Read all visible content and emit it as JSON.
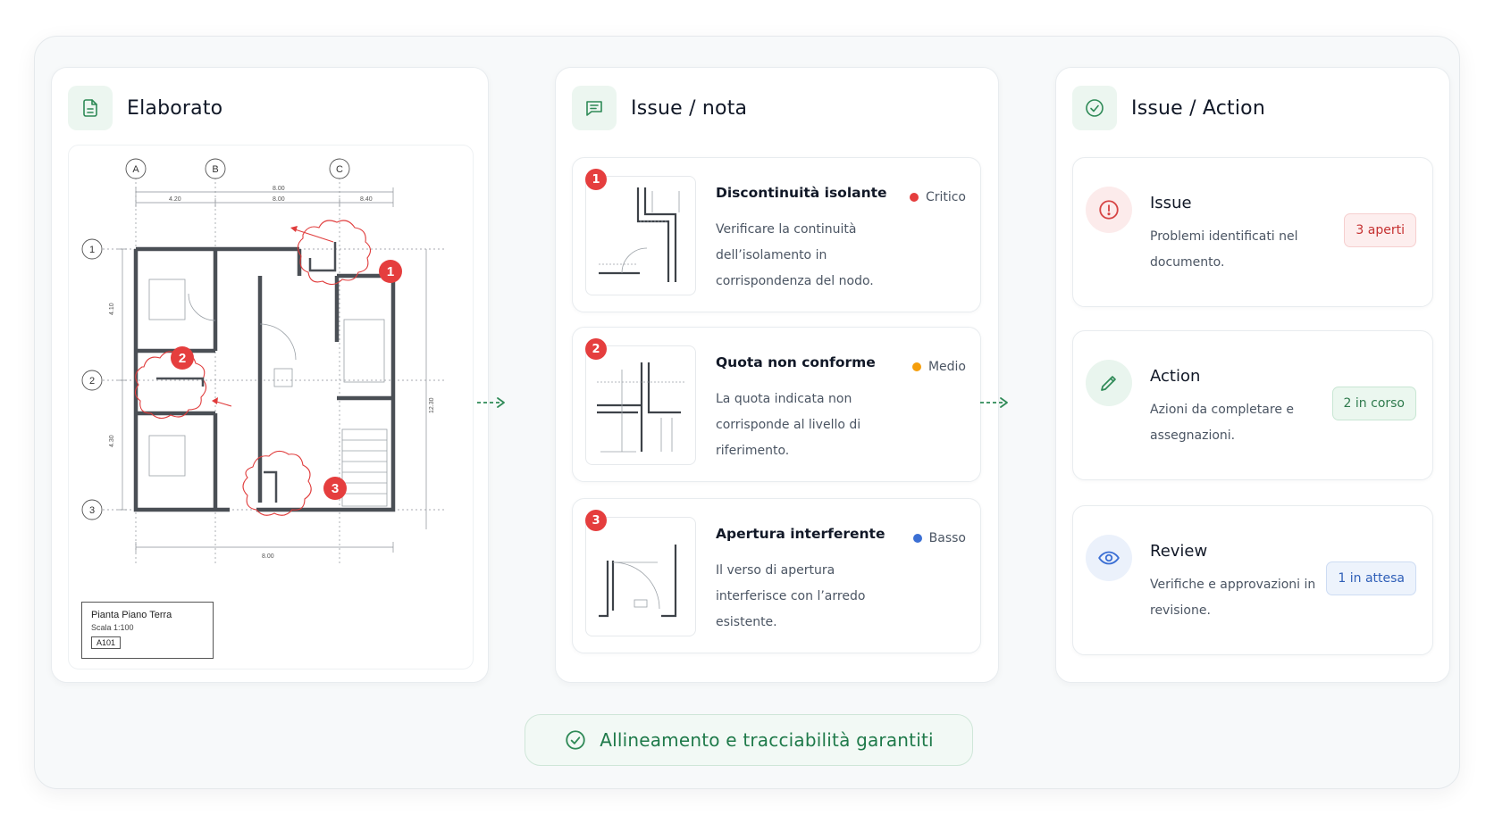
{
  "panels": {
    "document": {
      "title": "Elaborato",
      "icon": "document-icon",
      "drawing": {
        "column_labels": [
          "A",
          "B",
          "C"
        ],
        "row_labels": [
          "1",
          "2",
          "3"
        ],
        "dimensions": [
          "8.00",
          "4.20",
          "8.00",
          "8.40",
          "4.10",
          "4.30",
          "12.30",
          "8.00"
        ],
        "markers": [
          "1",
          "2",
          "3"
        ],
        "title_block": {
          "name": "Pianta Piano Terra",
          "scale": "Scala 1:100",
          "code": "A101"
        }
      }
    },
    "issues": {
      "title": "Issue / nota",
      "icon": "chat-note-icon",
      "items": [
        {
          "number": "1",
          "title": "Discontinuità isolante",
          "severity": "Critico",
          "severity_color": "#e53e3e",
          "description": "Verificare la continuità dell’isolamento in corrispondenza del nodo."
        },
        {
          "number": "2",
          "title": "Quota non conforme",
          "severity": "Medio",
          "severity_color": "#f59e0b",
          "description": "La quota indicata non corrisponde al livello di riferimento."
        },
        {
          "number": "3",
          "title": "Apertura interferente",
          "severity": "Basso",
          "severity_color": "#3b6fd4",
          "description": "Il verso di apertura interferisce con l’arredo esistente."
        }
      ]
    },
    "actions": {
      "title": "Issue / Action",
      "icon": "check-circle-icon",
      "items": [
        {
          "title": "Issue",
          "description": "Problemi identificati nel documento.",
          "pill": "3 aperti",
          "icon": "alert-icon",
          "color": "#d64545"
        },
        {
          "title": "Action",
          "description": "Azioni da completare e assegnazioni.",
          "pill": "2 in corso",
          "icon": "pencil-icon",
          "color": "#2f8a57"
        },
        {
          "title": "Review",
          "description": "Verifiche e approvazioni in revisione.",
          "pill": "1 in attesa",
          "icon": "eye-icon",
          "color": "#3b6fd4"
        }
      ]
    }
  },
  "footer": {
    "text": "Allineamento e tracciabilità garantiti",
    "icon": "check-circle-icon"
  },
  "colors": {
    "accent": "#2f8a57",
    "marker": "#e53e3e"
  }
}
